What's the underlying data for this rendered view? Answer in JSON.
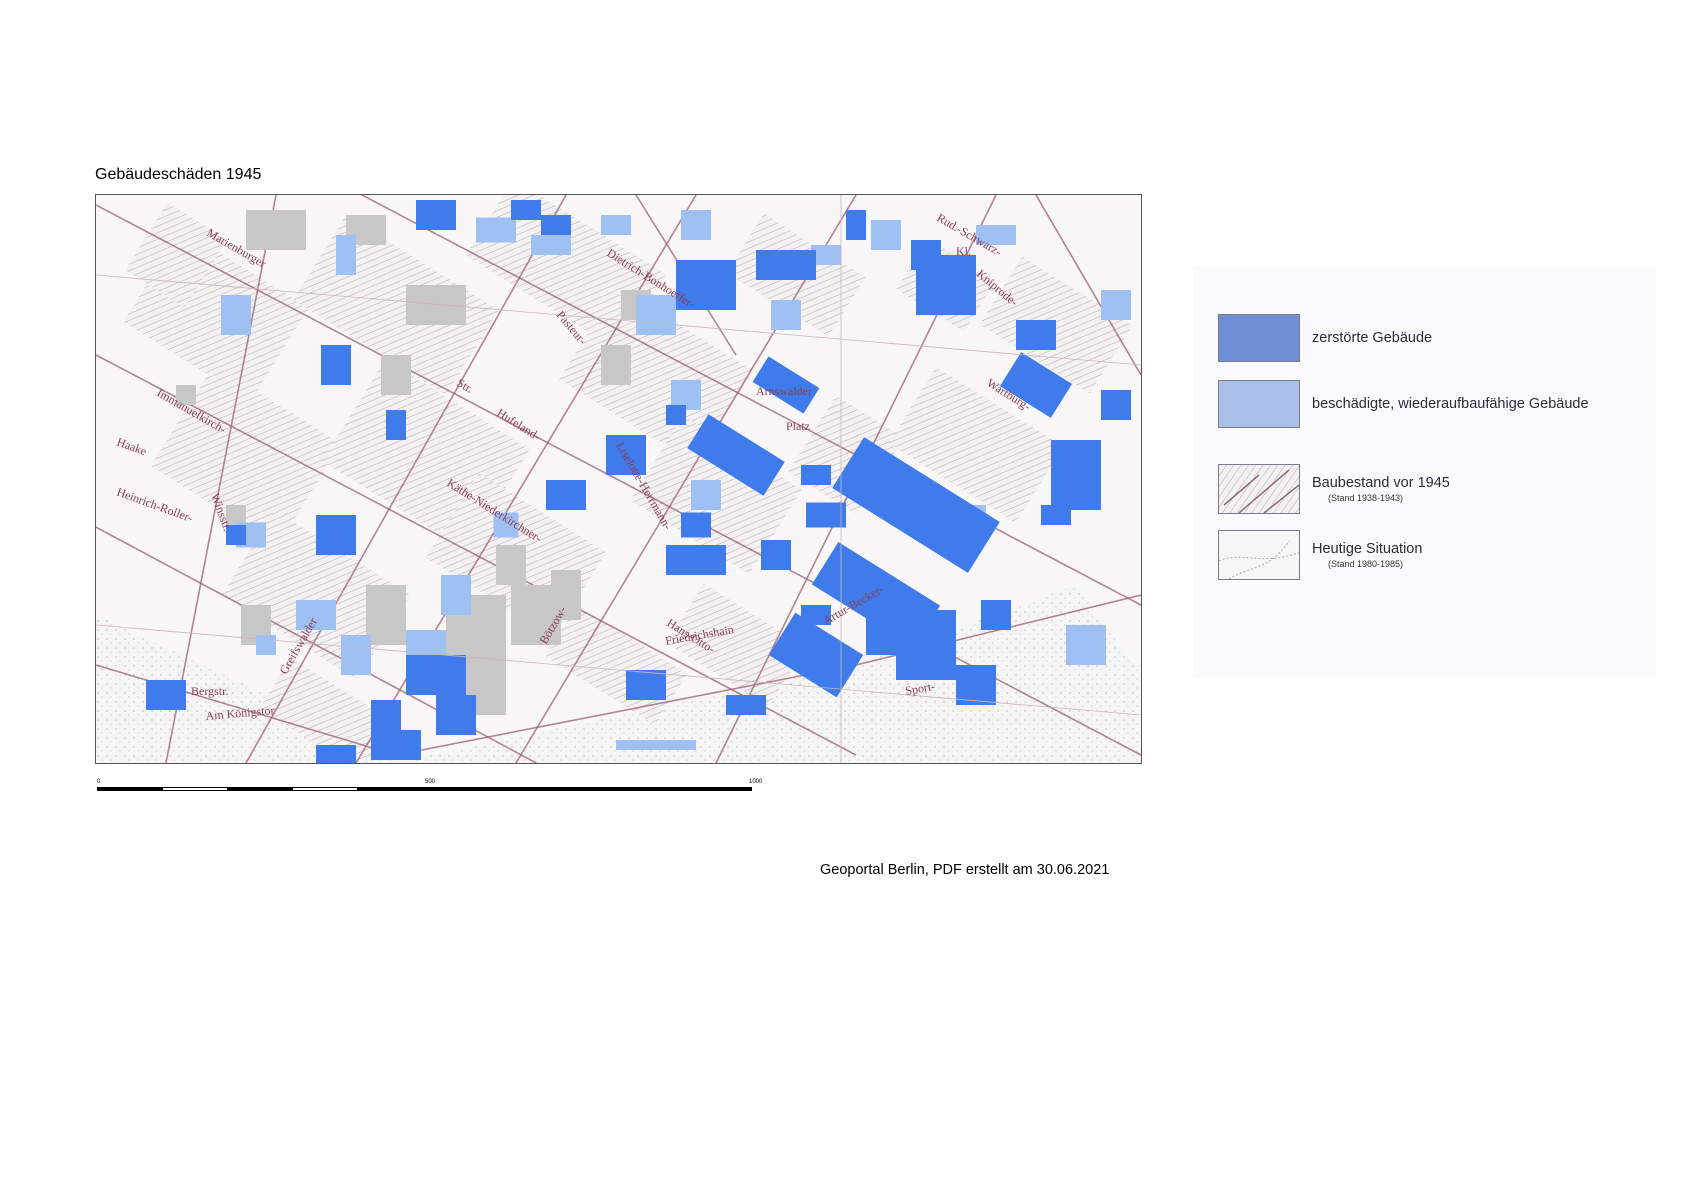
{
  "title": "Gebäudeschäden 1945",
  "map": {
    "street_labels": [
      "Marienburger",
      "Str.",
      "Immanuelkirch-",
      "Haake",
      "Heinrich-Roller-",
      "Winsstr.",
      "Greifswalder",
      "Hufeland-",
      "Käthe-Niederkirchner-",
      "Dietrich-Bonhoeffer-",
      "Pasteur-",
      "Liselotte-Herrmann-",
      "Hans-Otto-",
      "Arnswalder",
      "Platz",
      "Artur-Becker-",
      "Friedrichshain",
      "Am Königstor",
      "Bötzow-",
      "Rud.-Schwarz-",
      "Kniprode-",
      "Wartburg-",
      "Sport-",
      "Bergstr.",
      "Kl."
    ],
    "colors": {
      "destroyed": "#3f7bea",
      "damaged": "#9ec0f2",
      "pre1945_building": "#c7c7c7",
      "street_outline": "#9c5d70"
    }
  },
  "scale": {
    "ticks": [
      "0",
      "500",
      "1000"
    ]
  },
  "legend": {
    "destroyed": "zerstörte Gebäude",
    "damaged": "beschädigte, wiederaufbaufähige Gebäude",
    "before_1945": "Baubestand vor 1945",
    "before_1945_sub": "(Stand 1938-1943)",
    "today": "Heutige Situation",
    "today_sub": "(Stand 1980-1985)"
  },
  "footer": "Geoportal Berlin, PDF erstellt am  30.06.2021"
}
